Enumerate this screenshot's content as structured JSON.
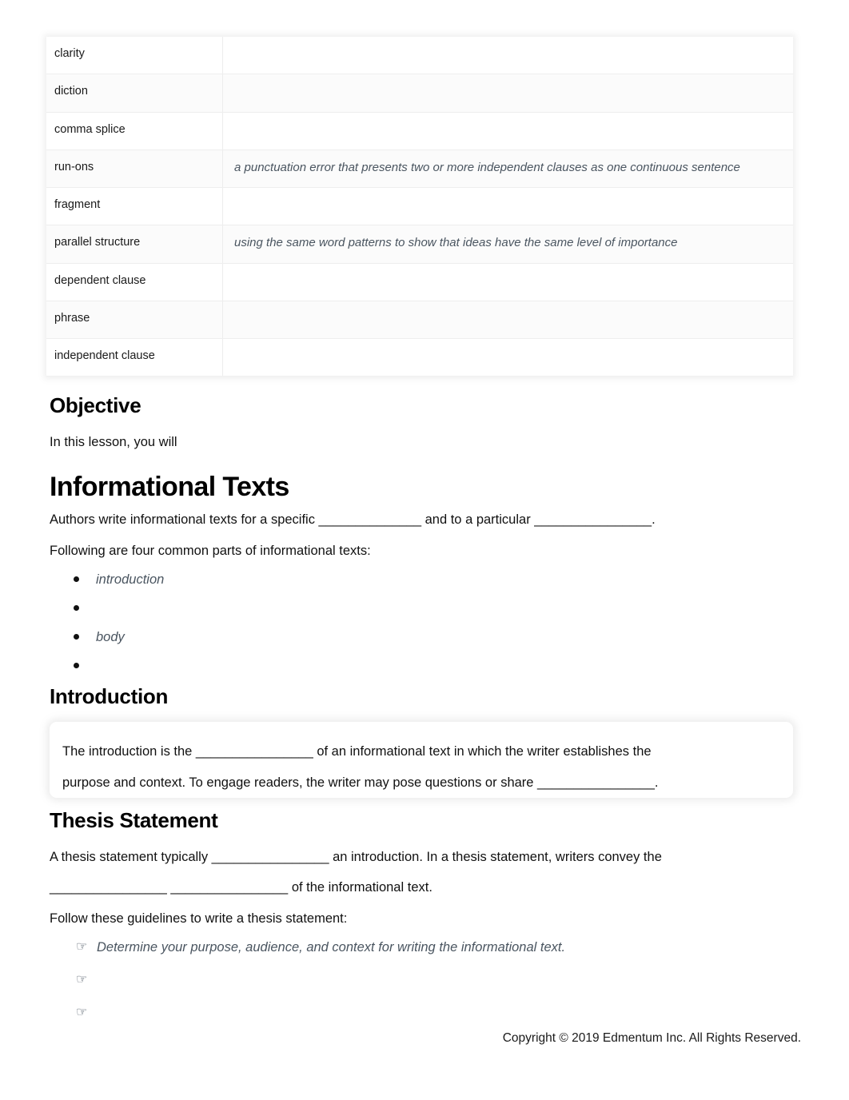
{
  "document": {
    "footer_text": "Copyright © 2019 Edmentum Inc. All Rights Reserved."
  },
  "vocab_table": {
    "rows": [
      {
        "term": "clarity",
        "definition": ""
      },
      {
        "term": "diction",
        "definition": ""
      },
      {
        "term": "comma splice",
        "definition": ""
      },
      {
        "term": "run-ons",
        "definition": "a punctuation error that presents two or more independent clauses as one continuous sentence"
      },
      {
        "term": "fragment",
        "definition": ""
      },
      {
        "term": "parallel structure",
        "definition": "using the same word patterns to show that ideas have the same level of importance"
      },
      {
        "term": "dependent clause",
        "definition": ""
      },
      {
        "term": "phrase",
        "definition": ""
      },
      {
        "term": "independent clause",
        "definition": ""
      }
    ]
  },
  "objective": {
    "heading": "Objective",
    "intro_text": "In this lesson, you will"
  },
  "informational_texts": {
    "heading": "Informational Texts",
    "paragraph_1": "Authors write informational texts for a specific ______________ and to a particular ________________.",
    "paragraph_2": "Following are four common parts of informational texts:",
    "parts": [
      {
        "label": "introduction"
      },
      {
        "label": ""
      },
      {
        "label": "body"
      },
      {
        "label": ""
      }
    ]
  },
  "introduction": {
    "heading": "Introduction",
    "callout_line_1": "The introduction is the ________________ of an informational text in which the writer establishes the",
    "callout_line_2": "purpose and context. To engage readers, the writer may pose questions or share ________________."
  },
  "thesis_statement": {
    "heading": "Thesis Statement",
    "paragraph_line_1": "A thesis statement typically ________________ an introduction. In a thesis statement, writers convey the",
    "paragraph_line_2": "________________ ________________ of the informational text.",
    "guidelines_intro": "Follow these guidelines to write a thesis statement:",
    "guideline_bullet_glyph": "☞",
    "guidelines": [
      {
        "text": "Determine your purpose, audience, and context for writing the informational text."
      },
      {
        "text": ""
      },
      {
        "text": ""
      }
    ]
  }
}
